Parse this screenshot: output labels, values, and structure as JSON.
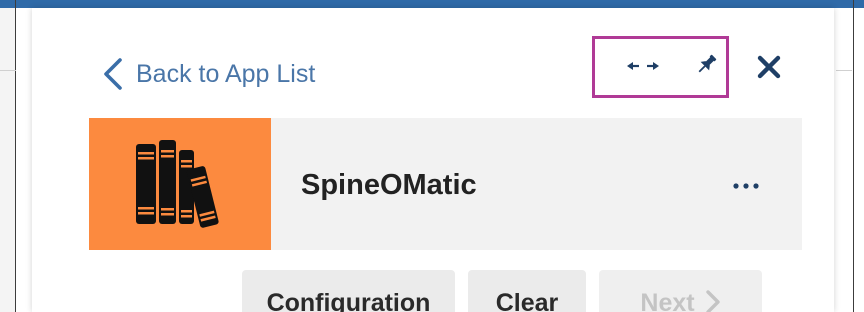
{
  "header": {
    "back_label": "Back to App List",
    "icons": {
      "back": "chevron-left-icon",
      "expand": "expand-horizontal-icon",
      "pin": "pin-icon",
      "close": "close-icon"
    }
  },
  "app": {
    "name": "SpineOMatic",
    "logo_icon": "books-icon",
    "more_icon": "more-horizontal-icon"
  },
  "actions": {
    "configuration_label": "Configuration",
    "clear_label": "Clear",
    "next_label": "Next"
  },
  "colors": {
    "accent": "#2f6aa8",
    "link": "#4a76a8",
    "logo_bg": "#fc8a3f",
    "highlight": "#b03a96",
    "card_bg": "#f2f2f2"
  }
}
